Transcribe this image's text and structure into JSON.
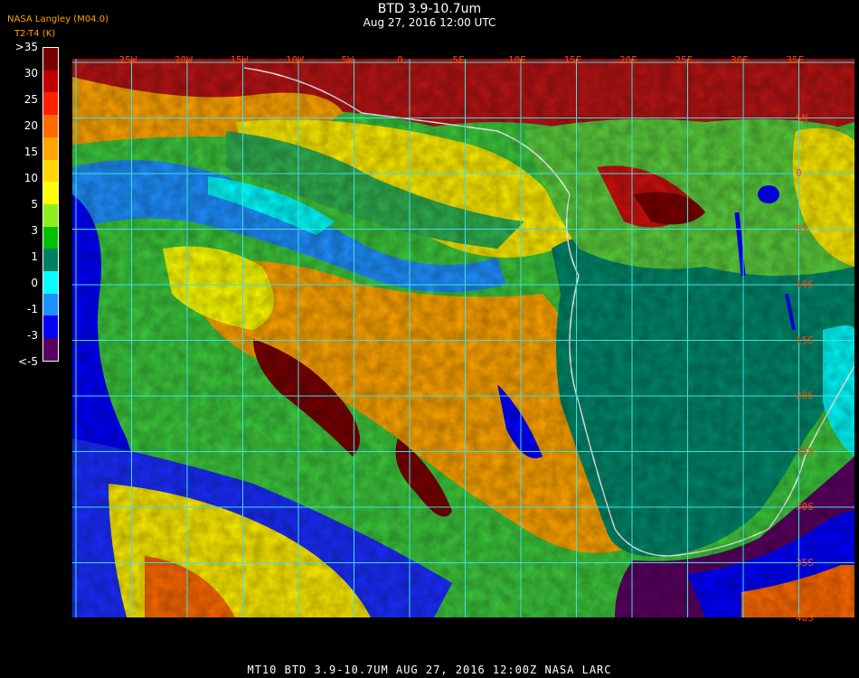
{
  "header": {
    "title": "BTD 3.9-10.7um",
    "subtitle": "Aug 27, 2016 12:00 UTC",
    "credit": "NASA Langley (M04.0)",
    "units": "T2-T4 (K)"
  },
  "colorbar": {
    "labels": [
      ">35",
      "30",
      "25",
      "20",
      "15",
      "10",
      "5",
      "3",
      "1",
      "0",
      "-1",
      "-3",
      "<-5"
    ],
    "colors": [
      "#7a0000",
      "#c00000",
      "#ff2000",
      "#ff6a00",
      "#ffa500",
      "#ffd700",
      "#ffff00",
      "#90ee20",
      "#00c000",
      "#008060",
      "#00ffff",
      "#1e90ff",
      "#0000ff",
      "#5a0060"
    ]
  },
  "grid": {
    "lat_labels": [
      "5N",
      "0",
      "5S",
      "10S",
      "15S",
      "20S",
      "25S",
      "30S",
      "35S",
      "40S"
    ],
    "lon_labels": [
      "25W",
      "20W",
      "15W",
      "10W",
      "5W",
      "0",
      "5E",
      "10E",
      "15E",
      "20E",
      "25E",
      "30E",
      "35E"
    ]
  },
  "footer": {
    "text": "MT10  BTD 3.9-10.7UM   AUG 27, 2016 12:00Z  NASA LARC"
  }
}
